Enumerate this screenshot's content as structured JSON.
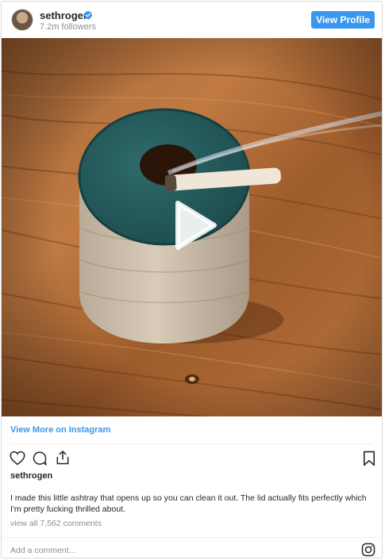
{
  "header": {
    "username": "sethrogen",
    "verified_icon": "verified-badge-icon",
    "followers": "7.2m followers",
    "view_profile_label": "View Profile"
  },
  "media": {
    "play_icon": "play-icon"
  },
  "footer": {
    "view_more_label": "View More on Instagram",
    "actions": [
      "heart-icon",
      "comment-icon",
      "share-icon",
      "bookmark-icon"
    ],
    "owner": "sethrogen",
    "caption": "I made this little ashtray that opens up so you can clean it out. The lid actually fits perfectly which I'm pretty fucking thrilled about.",
    "comments_link": "view all 7,562 comments",
    "add_comment_placeholder": "Add a comment...",
    "instagram_icon": "instagram-logo-icon"
  },
  "colors": {
    "brand_blue": "#3897f0",
    "link_blue": "#3897f0",
    "muted_text": "#8e8e8e",
    "border": "#dbdbdb"
  }
}
